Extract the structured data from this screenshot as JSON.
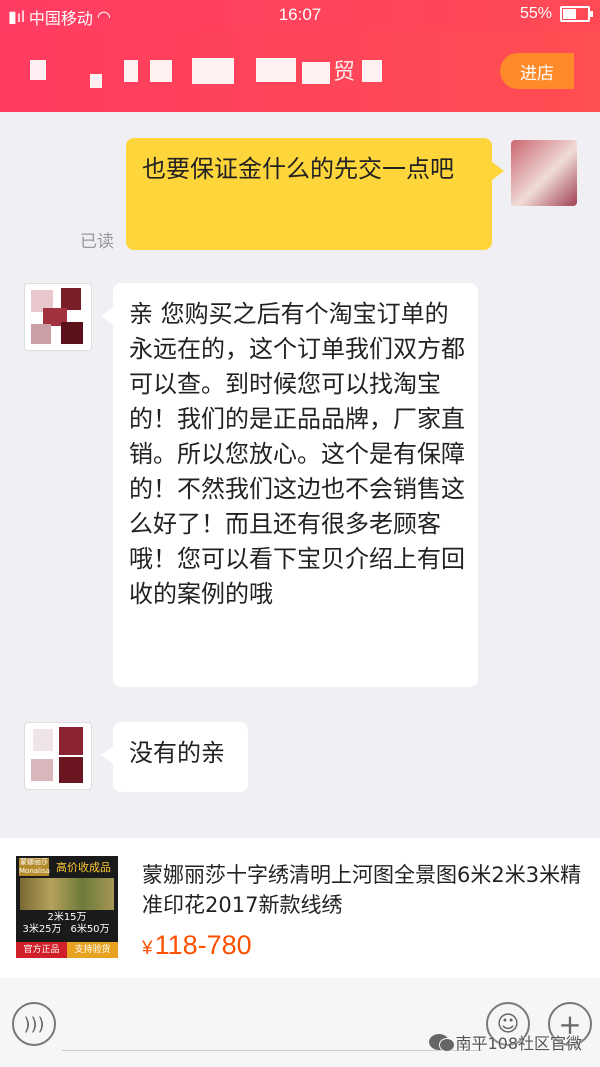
{
  "status_bar": {
    "carrier": "中国移动",
    "time": "16:07",
    "battery": "55%",
    "battery_level": 0.55
  },
  "nav": {
    "title_fragment": "贸",
    "shop_button": "进店"
  },
  "messages": {
    "m1": "也要保证金什么的先交一点吧",
    "read": "已读",
    "m2": "亲 您购买之后有个淘宝订单的永远在的，这个订单我们双方都可以查。到时候您可以找淘宝的！我们的是正品品牌，厂家直销。所以您放心。这个是有保障的！不然我们这边也不会销售这么好了！而且还有很多老顾客哦！您可以看下宝贝介绍上有回收的案例的哦",
    "m3": "没有的亲"
  },
  "product": {
    "title": "蒙娜丽莎十字绣清明上河图全景图6米2米3米精准印花2017新款线绣",
    "currency": "¥",
    "price": "118-780",
    "thumb": {
      "logo": "蒙娜丽莎 Monalisa",
      "headline": "高价收成品",
      "price_a": "2米15万",
      "price_b": "3米25万",
      "price_c": "6米50万",
      "badge_a": "官方正品",
      "badge_b": "支持验货"
    }
  },
  "watermark": "南平108社区官微"
}
